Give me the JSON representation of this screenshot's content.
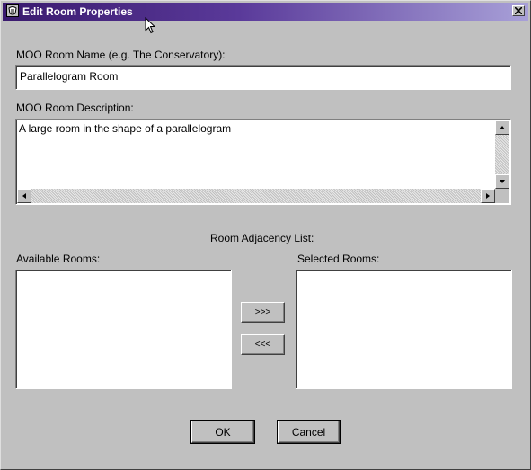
{
  "window": {
    "title": "Edit Room Properties"
  },
  "name_field": {
    "label": "MOO Room Name (e.g. The Conservatory):",
    "value": "Parallelogram Room"
  },
  "description": {
    "label": "MOO Room Description:",
    "value": "A large room in the shape of a parallelogram"
  },
  "adjacency": {
    "heading": "Room Adjacency List:",
    "available_label": "Available Rooms:",
    "selected_label": "Selected Rooms:",
    "add_label": ">>>",
    "remove_label": "<<<"
  },
  "buttons": {
    "ok": "OK",
    "cancel": "Cancel"
  }
}
